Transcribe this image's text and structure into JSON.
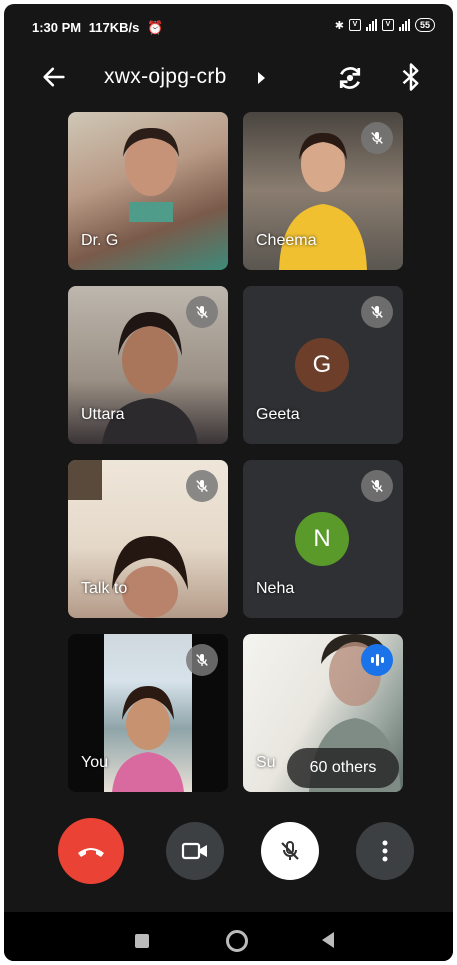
{
  "status_bar": {
    "time": "1:30 PM",
    "speed": "117KB/s",
    "battery": "55"
  },
  "meeting": {
    "code": "xwx-ojpg-crb"
  },
  "participants": [
    {
      "name": "Dr. G",
      "muted": false,
      "video": true
    },
    {
      "name": "Cheema",
      "muted": true,
      "video": true
    },
    {
      "name": "Uttara",
      "muted": true,
      "video": true
    },
    {
      "name": "Geeta",
      "muted": true,
      "video": false,
      "initial": "G",
      "avatar_color": "#6d3f2a"
    },
    {
      "name": "Talk to",
      "muted": true,
      "video": true
    },
    {
      "name": "Neha",
      "muted": true,
      "video": false,
      "initial": "N",
      "avatar_color": "#5a9a2a"
    },
    {
      "name": "You",
      "muted": true,
      "video": true
    },
    {
      "name": "Su",
      "muted": false,
      "video": true,
      "speaking": true
    }
  ],
  "others_label": "60 others",
  "controls": {
    "end_call_color": "#ea4335",
    "speaking_color": "#1a73e8"
  }
}
